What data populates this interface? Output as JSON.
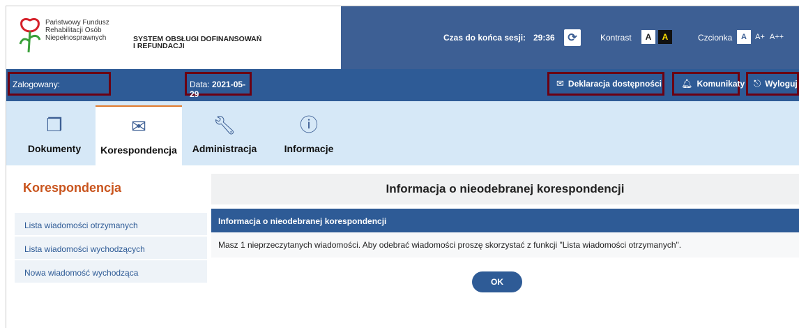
{
  "header": {
    "org_name": "Państwowy Fundusz\nRehabilitacji Osób\nNiepełnosprawnych",
    "system_name": "SYSTEM OBSŁUGI DOFINANSOWAŃ\nI REFUNDACJI",
    "session_label": "Czas do końca sesji:",
    "session_time": "29:36",
    "refresh_icon": "refresh-icon",
    "contrast_label": "Kontrast",
    "contrast_normal": "A",
    "contrast_high": "A",
    "font_label": "Czcionka",
    "font_normal": "A",
    "font_bigger": "A+",
    "font_biggest": "A++"
  },
  "bar": {
    "logged_label": "Zalogowany:",
    "date_label": "Data:",
    "date_value": "2021-05-29",
    "declaration": "Deklaracja dostępności",
    "messages": "Komunikaty",
    "logout": "Wyloguj"
  },
  "tabs": [
    {
      "label": "Dokumenty",
      "icon": "documents-icon"
    },
    {
      "label": "Korespondencja",
      "icon": "envelope-icon"
    },
    {
      "label": "Administracja",
      "icon": "wrench-icon"
    },
    {
      "label": "Informacje",
      "icon": "info-icon"
    }
  ],
  "sidebar": {
    "title": "Korespondencja",
    "items": [
      {
        "label": "Lista wiadomości otrzymanych"
      },
      {
        "label": "Lista wiadomości wychodzących"
      },
      {
        "label": "Nowa wiadomość wychodząca"
      }
    ]
  },
  "main": {
    "title": "Informacja o nieodebranej korespondencji",
    "panel_title": "Informacja o nieodebranej korespondencji",
    "message": "Masz 1 nieprzeczytanych wiadomości. Aby odebrać wiadomości proszę skorzystać z funkcji \"Lista wiadomości otrzymanych\".",
    "ok_label": "OK"
  },
  "colors": {
    "header_blue": "#3d5f94",
    "bar_blue": "#2e5b96",
    "tabs_bg": "#d6e8f7",
    "accent_orange": "#c9541d",
    "highlight_border": "#6b0012"
  }
}
